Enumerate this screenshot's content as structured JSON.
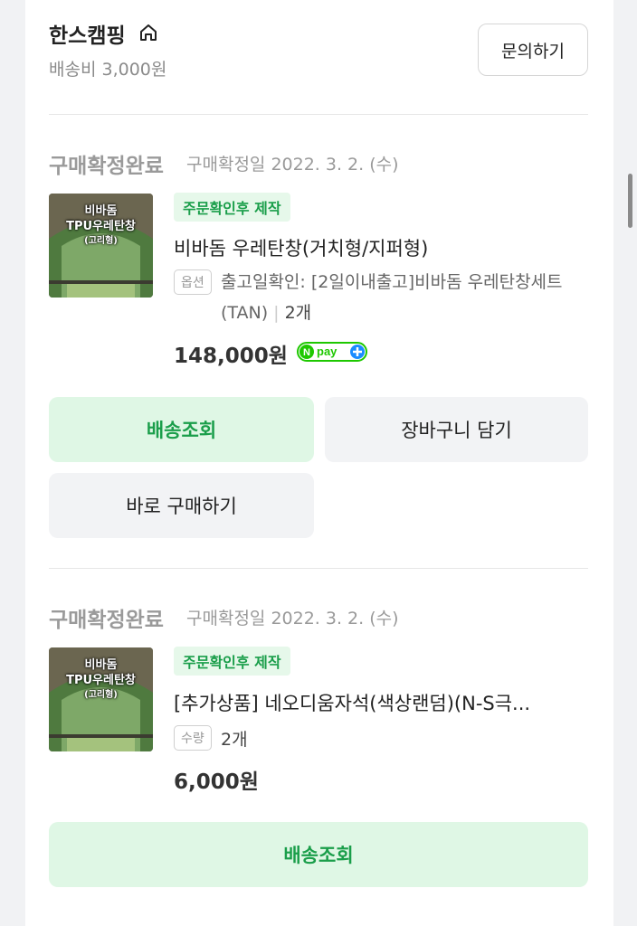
{
  "seller": {
    "name": "한스캠핑",
    "shipping_fee": "배송비 3,000원",
    "inquiry_label": "문의하기"
  },
  "orders": [
    {
      "status": "구매확정완료",
      "status_date": "구매확정일 2022. 3. 2. (수)",
      "thumbnail_text": [
        "비바돔",
        "TPU우레탄창",
        "(고리형)"
      ],
      "badge": "주문확인후 제작",
      "product_name": "비바돔 우레탄창(거치형/지퍼형)",
      "tag": "옵션",
      "option": "출고일확인: [2일이내출고]비바돔 우레탄창세트(TAN)",
      "quantity": "2개",
      "price": "148,000원",
      "buttons": [
        "배송조회",
        "장바구니 담기",
        "바로 구매하기"
      ]
    },
    {
      "status": "구매확정완료",
      "status_date": "구매확정일 2022. 3. 2. (수)",
      "thumbnail_text": [
        "비바돔",
        "TPU우레탄창",
        "(고리형)"
      ],
      "badge": "주문확인후 제작",
      "product_name": "[추가상품] 네오디움자석(색상랜덤)(N-S극...",
      "tag": "수량",
      "quantity": "2개",
      "price": "6,000원",
      "buttons": [
        "배송조회"
      ]
    }
  ],
  "colors": {
    "accent_green": "#1a9e4a",
    "green_bg": "#dff7e5",
    "gray_bg": "#f2f3f5",
    "page_bg": "#f1f2f4"
  },
  "icons": [
    "home-icon",
    "npay-plus-icon"
  ]
}
